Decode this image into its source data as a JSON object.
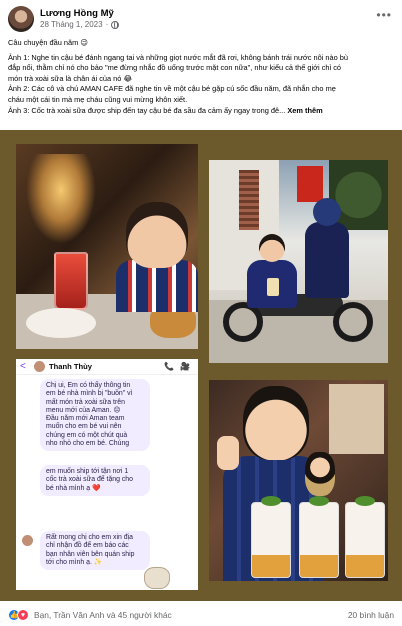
{
  "post": {
    "author": "Lương Hồng Mỹ",
    "date": "28 Tháng 1, 2023",
    "separator": "·",
    "more_label": "•••",
    "lines": [
      "Câu chuyện đầu năm 😉",
      "Ảnh 1: Nghe tin cậu bé đánh ngang tai và những giọt nước mắt đã rơi, không bánh trái nước nôi nào bù",
      "đắp nổi, thằm chỉ nó cho bảo \"me đừng nhắc đồ uống trước mặt con nữa\", như kiểu cả thế giới chỉ có",
      "món trà xoài sữa là chân ái của nó 😂",
      "Ảnh 2: Các cô và chú AMAN CAFE đã nghe tin về một cậu bé gặp cú sốc đầu năm, đã nhắn cho mẹ",
      "cháu một cái tin mà mẹ cháu cũng vui mừng khôn xiết.",
      "Ảnh 3: Cốc trà xoài sữa được ship đến tay cậu bé đa sầu đa cảm ấy ngay trong đê..."
    ],
    "see_more": "Xem thêm"
  },
  "chat": {
    "back_label": "<",
    "name": "Thanh Thùy",
    "call_label": "📞",
    "video_label": "🎥",
    "bubble1": [
      "Chị ui, Em có thấy thông tin",
      "em bé nhà mình bị \"buồn\" vì",
      "mất món trà xoài sữa trên",
      "menu mới của Aman. 😞",
      "Đầu năm mới Aman team",
      "muốn cho em bé vui nên",
      "chúng em có một chút quà",
      "nho nhỏ cho em bé. Chúng"
    ],
    "bubble2": [
      "em muốn ship tới tận nơi 1",
      "cốc trà xoài sữa để tặng cho",
      "bé nhà mình ạ ❤️"
    ],
    "bubble3": [
      "Rất mong chị cho em xin địa",
      "chỉ nhận đồ để em báo các",
      "bạn nhân viên bên quán ship",
      "tới cho mình ạ. ✨"
    ]
  },
  "footer": {
    "reactions_text": "Bạn, Trần Văn Anh và 45 người khác",
    "comments_text": "20 bình luận",
    "like_label": "👍",
    "heart_label": "♥"
  },
  "colors": {
    "gallery_bg": "#6d5a2c",
    "like_blue": "#1877f2",
    "heart_red": "#f33e58",
    "chat_purple": "#7b3ff2"
  }
}
